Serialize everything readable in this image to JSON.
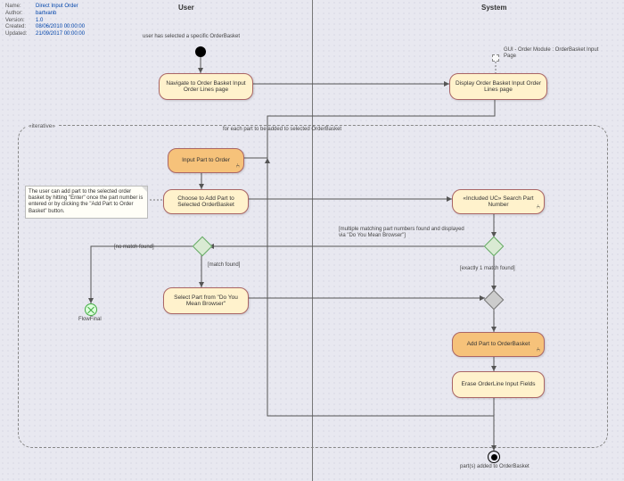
{
  "meta": {
    "name": "Direct Input Order",
    "author": "bartvanb",
    "version": "1.0",
    "created": "08/06/2010 00:00:00",
    "updated": "21/09/2017 00:00:00",
    "name_lab": "Name:",
    "author_lab": "Author:",
    "version_lab": "Version:",
    "created_lab": "Created:",
    "updated_lab": "Updated:"
  },
  "swimlanes": {
    "user": "User",
    "system": "System"
  },
  "start_note": "user has selected a specific OrderBasket",
  "gui_port": "GUI - Order Module : OrderBasket Input Page",
  "frame": {
    "tag": "«iterative»",
    "caption": "for each part to be added to selected OrderBasket"
  },
  "acts": {
    "nav": "Navigate to Order Basket Input Order Lines page",
    "disp": "Display Order Basket Input Order Lines page",
    "input": "Input Part to Order",
    "choose": "Choose to Add Part to Selected OrderBasket",
    "search": "«Included UC» Search Part Number",
    "select": "Select Part from \"Do You Mean Browser\"",
    "add": "Add Part to OrderBasket",
    "erase": "Erase OrderLine Input Fields"
  },
  "note": "The user can add part to the selected order basket by hitting \"Enter\" once the part number is entered or by clicking the \"Add Part to Order Basket\" button.",
  "guards": {
    "nomatch": "[no match found]",
    "match": "[match found]",
    "multi": "[multiple matching part numbers found and displayed via \"Do You Mean Browser\"]",
    "one": "[exactly 1 match found]"
  },
  "flowfinal_lab": "FlowFinal",
  "end_lab": "part(s) added to OrderBasket",
  "sub_icon": "⑃"
}
